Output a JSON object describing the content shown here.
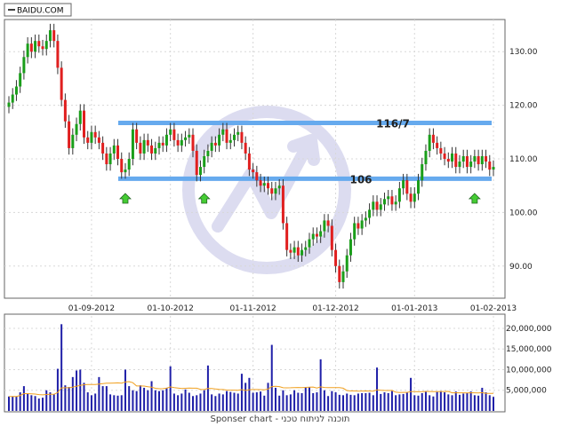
{
  "legend": {
    "symbol": "BAIDU.COM"
  },
  "sponsor_text": "Sponser chart - תוכנה לניתוח טכני",
  "colors": {
    "up": "#1a9e1a",
    "down": "#e01f1f",
    "wick": "#333333",
    "level_line": "#66aaee",
    "volume_bar": "#1f1fa8",
    "volume_ma": "#f0a020",
    "arrow": "#44cc33",
    "watermark": "#dcdcf0",
    "frame": "#666666",
    "grid": "#d8d8d8"
  },
  "chart_data": [
    {
      "type": "candlestick",
      "title": "",
      "ylim": [
        84,
        136
      ],
      "yticks": [
        "90.00",
        "100.00",
        "110.00",
        "120.00",
        "130.00"
      ],
      "x_tick_labels": [
        "01-09-2012",
        "01-10-2012",
        "01-11-2012",
        "01-12-2012",
        "01-01-2013",
        "01-02-2013"
      ],
      "x_tick_index": [
        22,
        43,
        65,
        87,
        108,
        129
      ],
      "levels": [
        {
          "label": "116/7",
          "value": 116.7
        },
        {
          "label": "106",
          "value": 106.3
        }
      ],
      "arrow_markers": [
        31,
        52,
        124
      ],
      "closes": [
        120.5,
        122.0,
        123.5,
        126.0,
        129.0,
        131.5,
        130.0,
        132.0,
        131.0,
        130.5,
        132.0,
        134.0,
        132.0,
        127.0,
        121.0,
        117.0,
        112.0,
        114.5,
        116.5,
        119.0,
        114.0,
        113.0,
        115.0,
        114.0,
        113.0,
        111.0,
        109.0,
        111.0,
        112.5,
        110.0,
        107.5,
        108.0,
        110.0,
        115.5,
        113.0,
        111.0,
        113.5,
        112.5,
        111.0,
        112.0,
        113.0,
        112.5,
        114.5,
        115.5,
        113.5,
        112.5,
        113.5,
        114.0,
        114.5,
        111.5,
        107.0,
        108.5,
        110.5,
        111.5,
        113.0,
        112.5,
        114.5,
        115.5,
        113.0,
        113.5,
        114.5,
        115.0,
        113.0,
        111.0,
        108.0,
        107.5,
        106.0,
        105.0,
        105.5,
        104.5,
        103.5,
        104.5,
        105.0,
        98.0,
        93.0,
        92.5,
        93.5,
        92.0,
        93.0,
        93.5,
        95.0,
        96.0,
        95.5,
        96.5,
        98.5,
        97.5,
        93.0,
        90.0,
        87.0,
        89.0,
        92.0,
        95.0,
        98.0,
        97.0,
        98.5,
        99.0,
        100.5,
        102.0,
        100.5,
        101.5,
        102.5,
        103.0,
        101.5,
        102.0,
        104.5,
        106.0,
        103.5,
        102.0,
        103.5,
        106.0,
        109.0,
        111.5,
        114.5,
        113.0,
        112.0,
        111.0,
        110.0,
        109.5,
        111.0,
        108.5,
        109.5,
        110.5,
        108.5,
        109.5,
        110.5,
        109.0,
        110.5,
        109.5,
        108.0,
        108.5
      ],
      "volumes": [
        3500000,
        3500000,
        3500000,
        4500000,
        6000000,
        4200000,
        3800000,
        3600000,
        3000000,
        3200000,
        5000000,
        4500000,
        4000000,
        10200000,
        21000000,
        6200000,
        5800000,
        8200000,
        9800000,
        10000000,
        6800000,
        4500000,
        3800000,
        4200000,
        8200000,
        6000000,
        6000000,
        4000000,
        3800000,
        3700000,
        3800000,
        10000000,
        6000000,
        5000000,
        4800000,
        6200000,
        5600000,
        5000000,
        7200000,
        5000000,
        4800000,
        5000000,
        5600000,
        10800000,
        4200000,
        3800000,
        4200000,
        5200000,
        4400000,
        3600000,
        3800000,
        4200000,
        5000000,
        11000000,
        4000000,
        3600000,
        4200000,
        4000000,
        4800000,
        4600000,
        4400000,
        4200000,
        9000000,
        6800000,
        8000000,
        4400000,
        4500000,
        4700000,
        3700000,
        6800000,
        16000000,
        5600000,
        3700000,
        5000000,
        3800000,
        4000000,
        5000000,
        4400000,
        4300000,
        5800000,
        5700000,
        4300000,
        4500000,
        12500000,
        5000000,
        3600000,
        4800000,
        4500000,
        3900000,
        3800000,
        4200000,
        3900000,
        3800000,
        4200000,
        4300000,
        4300000,
        4400000,
        3800000,
        10500000,
        4100000,
        4500000,
        4300000,
        4800000,
        3800000,
        4000000,
        4100000,
        4500000,
        8000000,
        3800000,
        3700000,
        4300000,
        4800000,
        3800000,
        3500000,
        4600000,
        4800000,
        4500000,
        4000000,
        3800000,
        4700000,
        3900000,
        4200000,
        4300000,
        4700000,
        3800000,
        3700000,
        5600000,
        4500000,
        3800000,
        3400000
      ],
      "volume_ylim": [
        0,
        23000000
      ],
      "volume_yticks": [
        "5,000,000",
        "10,000,000",
        "15,000,000",
        "20,000,000"
      ]
    }
  ]
}
